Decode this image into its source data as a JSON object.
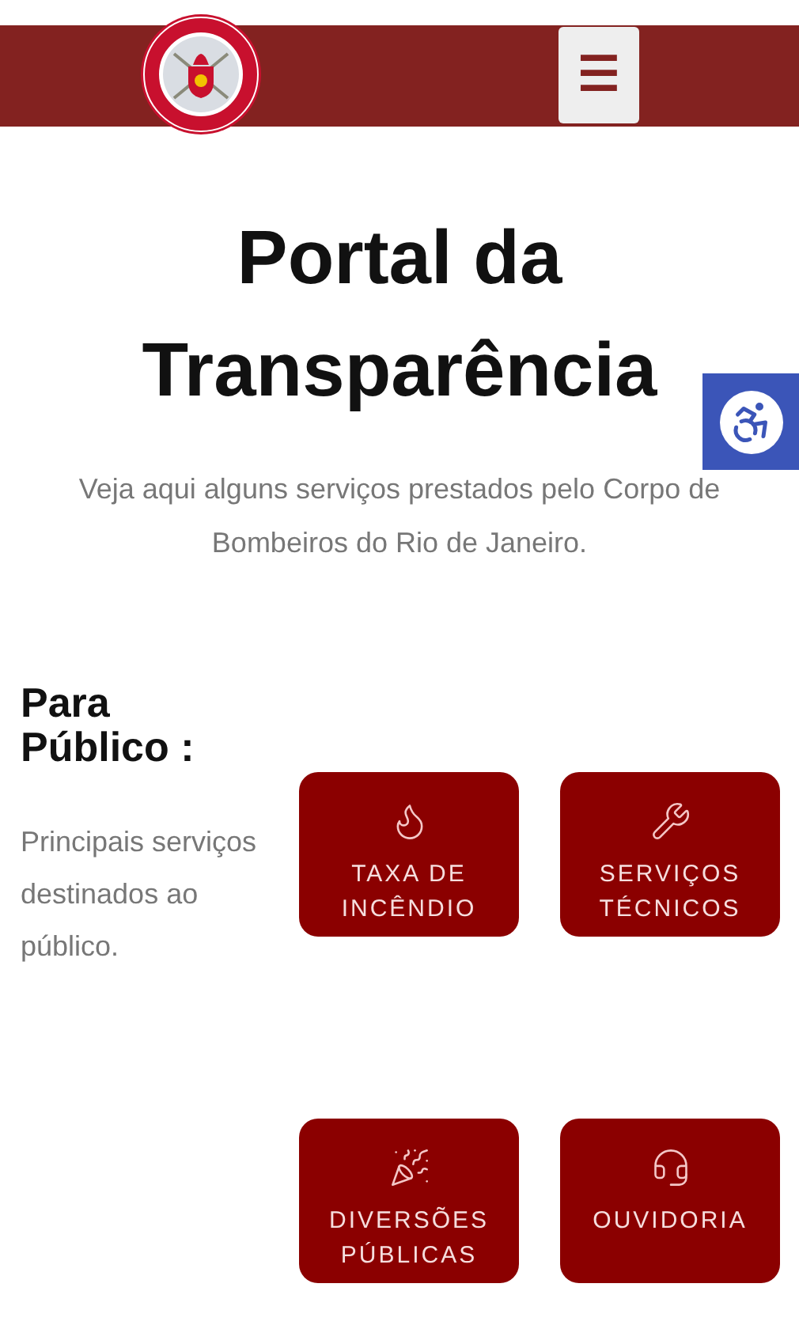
{
  "header": {
    "menu_button": "☰"
  },
  "hero": {
    "title": "Portal da Transparência",
    "subtitle": "Veja aqui alguns serviços prestados pelo Corpo de Bombeiros do Rio de Janeiro."
  },
  "section": {
    "heading": "Para Público :",
    "description": "Principais serviços destinados ao público."
  },
  "services": [
    {
      "kind": "fire",
      "label": "TAXA DE INCÊNDIO"
    },
    {
      "kind": "tools",
      "label": "SERVIÇOS TÉCNICOS"
    },
    {
      "kind": "party",
      "label": "DIVERSÕES PÚBLICAS"
    },
    {
      "kind": "headset",
      "label": "OUVIDORIA"
    }
  ]
}
